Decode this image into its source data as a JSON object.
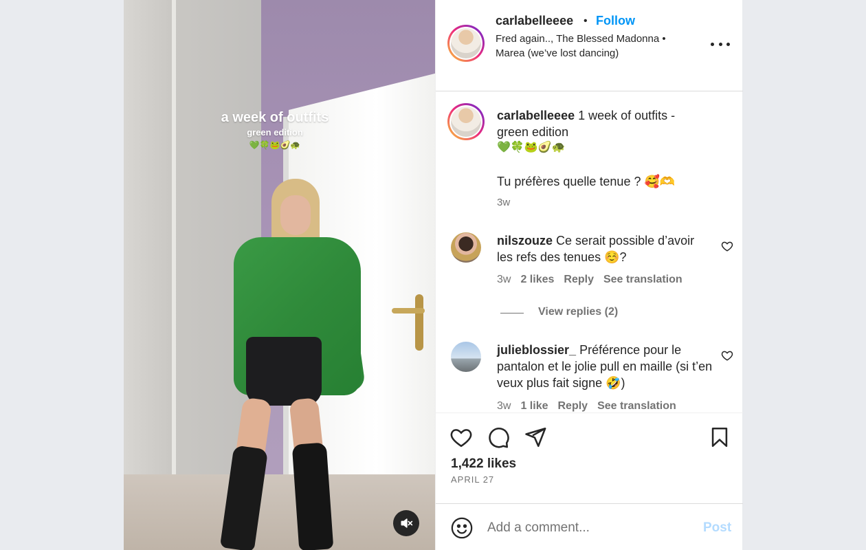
{
  "media": {
    "overlay_title": "a week of outfits",
    "overlay_subtitle": "green edition",
    "overlay_emoji": "💚🍀🐸🥑🐢",
    "mute_icon": "speaker-muted-icon"
  },
  "header": {
    "username": "carlabelleeee",
    "separator": "•",
    "follow_label": "Follow",
    "audio": "Fred again.., The Blessed Madonna • Marea (we’ve lost dancing)"
  },
  "caption": {
    "username": "carlabelleeee",
    "text": " 1 week of outfits - green edition",
    "emoji": "💚🍀🐸🥑🐢",
    "question": "Tu préfères quelle tenue ? 🥰🫶",
    "time": "3w"
  },
  "comments": [
    {
      "username": "nilszouze",
      "text": " Ce serait possible d’avoir les refs des tenues ☺️?",
      "time": "3w",
      "likes": "2 likes",
      "reply": "Reply",
      "translate": "See translation"
    },
    {
      "username": "julieblossier_",
      "text": " Préférence pour le pantalon et le jolie pull en maille (si t’en veux plus fait signe 🤣)",
      "time": "3w",
      "likes": "1 like",
      "reply": "Reply",
      "translate": "See translation"
    }
  ],
  "view_replies": "View replies (2)",
  "stats": {
    "likes": "1,422 likes",
    "date": "APRIL 27"
  },
  "add_comment": {
    "placeholder": "Add a comment...",
    "post_label": "Post"
  },
  "colors": {
    "follow_blue": "#0095f6",
    "post_disabled": "#b3dbff",
    "secondary_text": "#737373"
  }
}
